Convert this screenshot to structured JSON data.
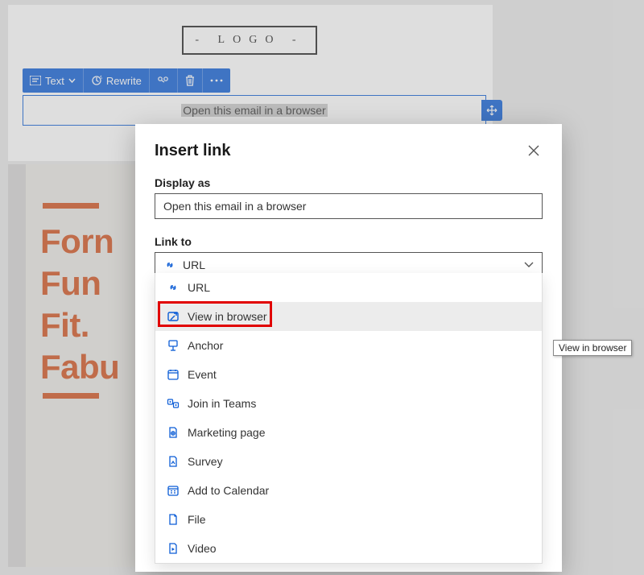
{
  "logo": {
    "text": "- LOGO -"
  },
  "toolbar": {
    "text_label": "Text",
    "rewrite_label": "Rewrite",
    "more_ellipsis": "…"
  },
  "editor": {
    "selected_text": "Open this email in a browser"
  },
  "hero": {
    "line1": "Forn",
    "line2": "Fun",
    "line3": "Fit.",
    "line4": "Fabu"
  },
  "dialog": {
    "title": "Insert link",
    "display_as_label": "Display as",
    "display_as_value": "Open this email in a browser",
    "link_to_label": "Link to",
    "link_to_selected": "URL",
    "options": [
      "URL",
      "View in browser",
      "Anchor",
      "Event",
      "Join in Teams",
      "Marketing page",
      "Survey",
      "Add to Calendar",
      "File",
      "Video"
    ],
    "highlighted_index": 1
  },
  "tooltip": "View in browser"
}
